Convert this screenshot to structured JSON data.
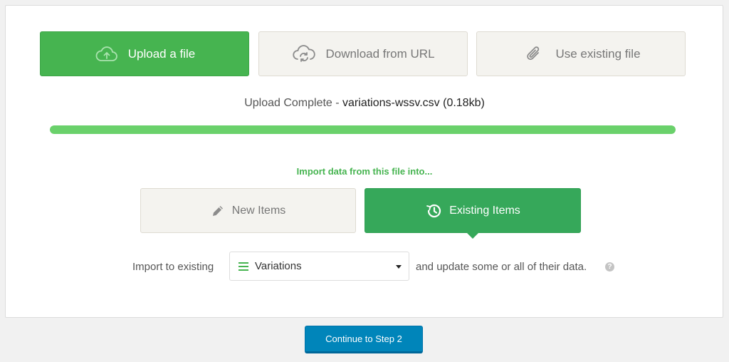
{
  "source_options": {
    "upload": {
      "label": "Upload a file",
      "icon": "cloud-upload-icon"
    },
    "download": {
      "label": "Download from URL",
      "icon": "cloud-sync-icon"
    },
    "existing": {
      "label": "Use existing file",
      "icon": "paperclip-icon"
    }
  },
  "status": {
    "prefix": "Upload Complete",
    "separator": " - ",
    "filename": "variations-wssv.csv",
    "size": "(0.18kb)",
    "progress": 1.0
  },
  "import_target": {
    "heading": "Import data from this file into...",
    "new_items_label": "New Items",
    "existing_items_label": "Existing Items",
    "selected": "existing"
  },
  "import_row": {
    "prefix": "Import to existing",
    "selected_type": "Variations",
    "suffix": "and update some or all of their data.",
    "help_glyph": "?"
  },
  "continue_button": {
    "label": "Continue to Step 2"
  },
  "colors": {
    "green_active": "#46b450",
    "green_existing": "#36a85a",
    "progress": "#6ad16b",
    "blue_button": "#0085ba"
  }
}
